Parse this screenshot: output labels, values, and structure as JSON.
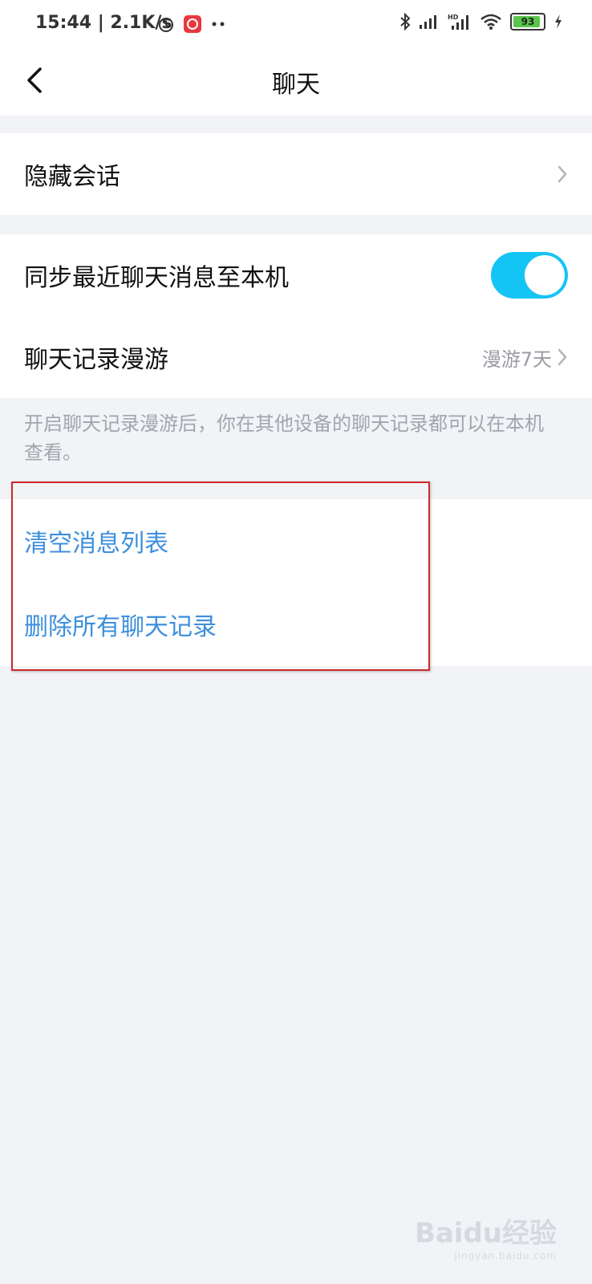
{
  "status_bar": {
    "time": "15:44 | 2.1K/s",
    "battery": "93",
    "battery_level": 0.93,
    "icons_left": [
      "alarm-icon",
      "app-notification-icon",
      "more-dots-icon"
    ],
    "icons_right": [
      "bluetooth-icon",
      "signal-icon",
      "hd-signal-icon",
      "wifi-icon",
      "battery-icon",
      "charging-icon"
    ]
  },
  "header": {
    "title": "聊天",
    "back_icon": "back-arrow-icon"
  },
  "settings": {
    "hidden_chats": {
      "label": "隐藏会话"
    },
    "sync_messages": {
      "label": "同步最近聊天消息至本机",
      "enabled": true
    },
    "chat_roaming": {
      "label": "聊天记录漫游",
      "value": "漫游7天"
    },
    "roaming_note": "开启聊天记录漫游后，你在其他设备的聊天记录都可以在本机查看。"
  },
  "actions": {
    "clear_list": "清空消息列表",
    "delete_all": "删除所有聊天记录"
  },
  "watermark": {
    "brand": "Baidu经验",
    "sub": "jingyan.baidu.com"
  },
  "colors": {
    "accent_blue": "#3d8fdd",
    "toggle_on": "#14c4f4",
    "highlight_red": "#cc2a2a",
    "background": "#f2f3f7"
  }
}
